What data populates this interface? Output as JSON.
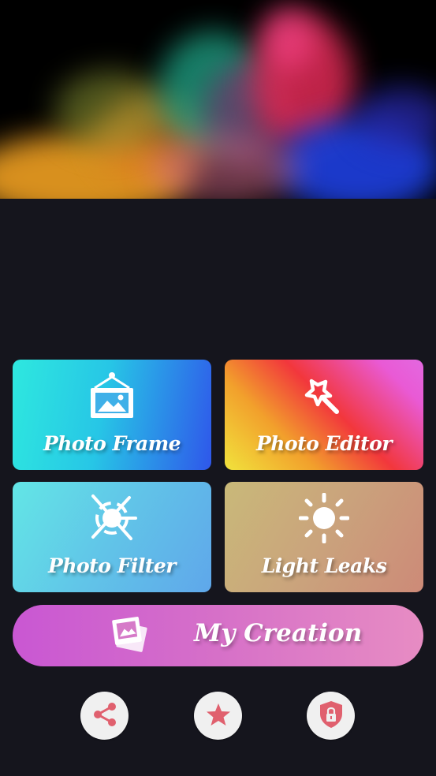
{
  "hero": {
    "image": "colorful-powder-explosion"
  },
  "tiles": {
    "photo_frame": {
      "label": "Photo Frame",
      "icon": "picture-frame-icon"
    },
    "photo_editor": {
      "label": "Photo Editor",
      "icon": "magic-wand-icon"
    },
    "photo_filter": {
      "label": "Photo Filter",
      "icon": "aperture-filter-icon"
    },
    "light_leaks": {
      "label": "Light Leaks",
      "icon": "sun-icon"
    }
  },
  "my_creation": {
    "label": "My Creation",
    "icon": "photo-stack-icon"
  },
  "bottom_actions": [
    {
      "name": "share",
      "icon": "share-icon"
    },
    {
      "name": "rate",
      "icon": "star-icon"
    },
    {
      "name": "privacy",
      "icon": "lock-shield-icon"
    }
  ],
  "colors": {
    "background": "#15151d",
    "action_icon": "#e0606e",
    "circle_bg": "#f0f0f0"
  }
}
